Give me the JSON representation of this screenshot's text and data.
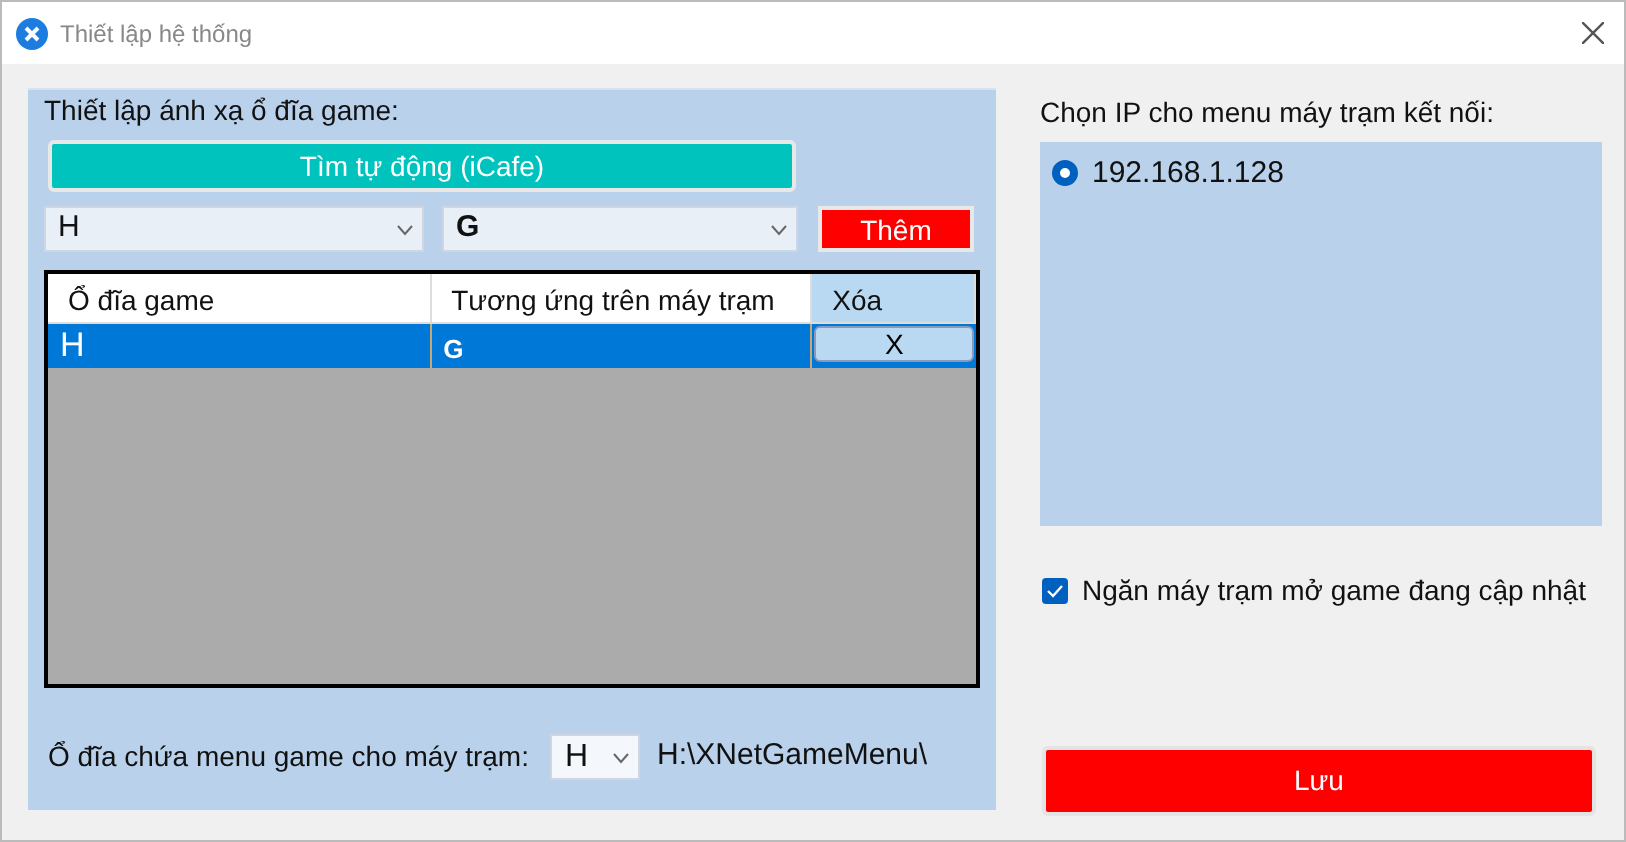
{
  "window": {
    "title": "Thiết lập hệ thống"
  },
  "mapping": {
    "title": "Thiết lập ánh xạ ổ đĩa game:",
    "auto_button": "Tìm tự động (iCafe)",
    "source_drive": {
      "value": "H"
    },
    "target_drive": {
      "value": "G"
    },
    "add_button": "Thêm",
    "table": {
      "columns": [
        "Ổ đĩa game",
        "Tương ứng trên máy trạm",
        "Xóa"
      ],
      "rows": [
        {
          "cells": [
            "H",
            "G"
          ],
          "delete": "X",
          "selected": true
        }
      ]
    },
    "menu_drive": {
      "label": "Ổ đĩa chứa menu game cho máy trạm:",
      "value": "H",
      "path": "H:\\XNetGameMenu\\"
    }
  },
  "ip": {
    "title": "Chọn IP cho menu máy trạm kết nối:",
    "options": [
      {
        "label": "192.168.1.128",
        "selected": true
      }
    ]
  },
  "block_update": {
    "label": "Ngăn máy trạm mở game đang cập nhật",
    "checked": true
  },
  "save_button": "Lưu"
}
